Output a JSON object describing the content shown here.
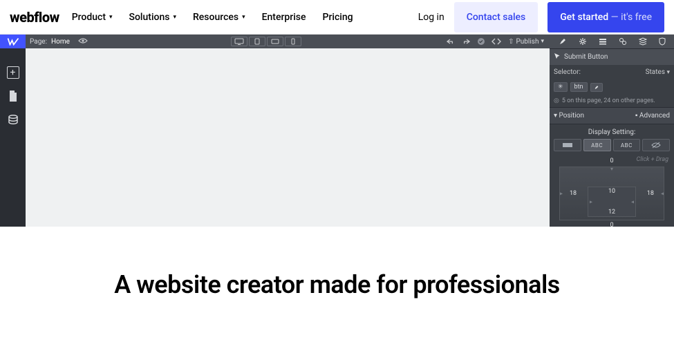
{
  "brand": "webflow",
  "nav": {
    "items": [
      "Product",
      "Solutions",
      "Resources",
      "Enterprise",
      "Pricing"
    ],
    "login": "Log in",
    "contact": "Contact sales",
    "getstarted_main": "Get started",
    "getstarted_suffix": " — it's free"
  },
  "editor": {
    "page_label": "Page:",
    "page_name": "Home",
    "publish": "Publish",
    "submit_btn": "Submit Button",
    "selector_label": "Selector:",
    "states_label": "States",
    "tag_btn": "btn",
    "count": "5 on this page, 24 on other pages.",
    "position_label": "Position",
    "advanced_label": "Advanced",
    "display_setting": "Display Setting:",
    "disp_opts": [
      "",
      "ABC",
      "ABC",
      ""
    ],
    "box_top": "0",
    "box_left": "18",
    "box_right": "18",
    "box_bottom": "0",
    "box_inner_top": "10",
    "box_inner_bottom": "12",
    "hand_note": "Click + Drag"
  },
  "headline": "A website creator made for professionals"
}
